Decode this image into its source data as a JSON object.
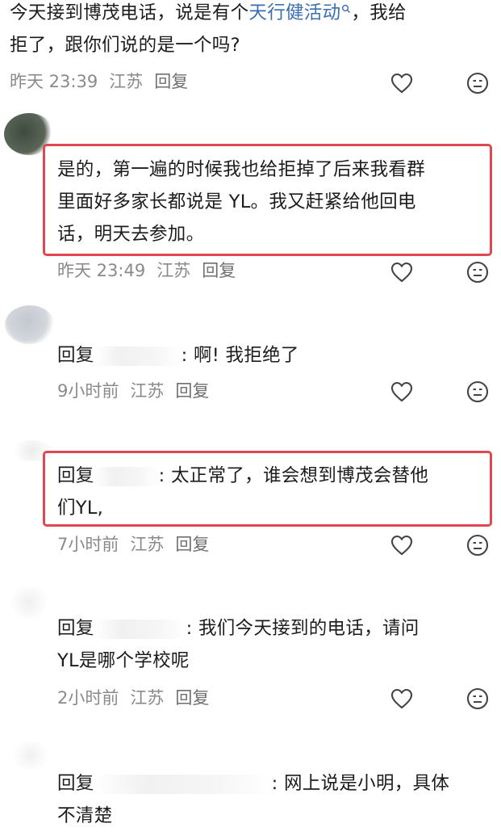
{
  "comments": [
    {
      "line1_before": "今天接到博茂电话，说是有个",
      "link_text": "天行健活动",
      "line1_after": "，我给",
      "line2": "拒了，跟你们说的是一个吗?",
      "time": "昨天 23:39",
      "location": "江苏",
      "reply_label": "回复"
    },
    {
      "line1": "是的，第一遍的时候我也给拒掉了后来我看群",
      "line2": "里面好多家长都说是 YL。我又赶紧给他回电",
      "line3": "话，明天去参加。",
      "time": "昨天 23:49",
      "location": "江苏",
      "reply_label": "回复"
    },
    {
      "reply_prefix": "回复",
      "line1_after": ": 啊! 我拒绝了",
      "time": "9小时前",
      "location": "江苏",
      "reply_label": "回复"
    },
    {
      "reply_prefix": "回复",
      "line1_after": ": 太正常了，谁会想到博茂会替他",
      "line2": "们YL,",
      "time": "7小时前",
      "location": "江苏",
      "reply_label": "回复"
    },
    {
      "reply_prefix": "回复",
      "line1_after": ": 我们今天接到的电话，请问",
      "line2": "YL是哪个学校呢",
      "time": "2小时前",
      "location": "江苏",
      "reply_label": "回复"
    },
    {
      "reply_prefix": "回复",
      "line1_after": ": 网上说是小明，具体",
      "line2": "不清楚"
    }
  ],
  "colors": {
    "highlight_border": "#e0484f",
    "link": "#3a6eb5",
    "meta": "#8a8a8a"
  },
  "icons": [
    "heart-icon",
    "search-icon",
    "emoji-icon"
  ]
}
